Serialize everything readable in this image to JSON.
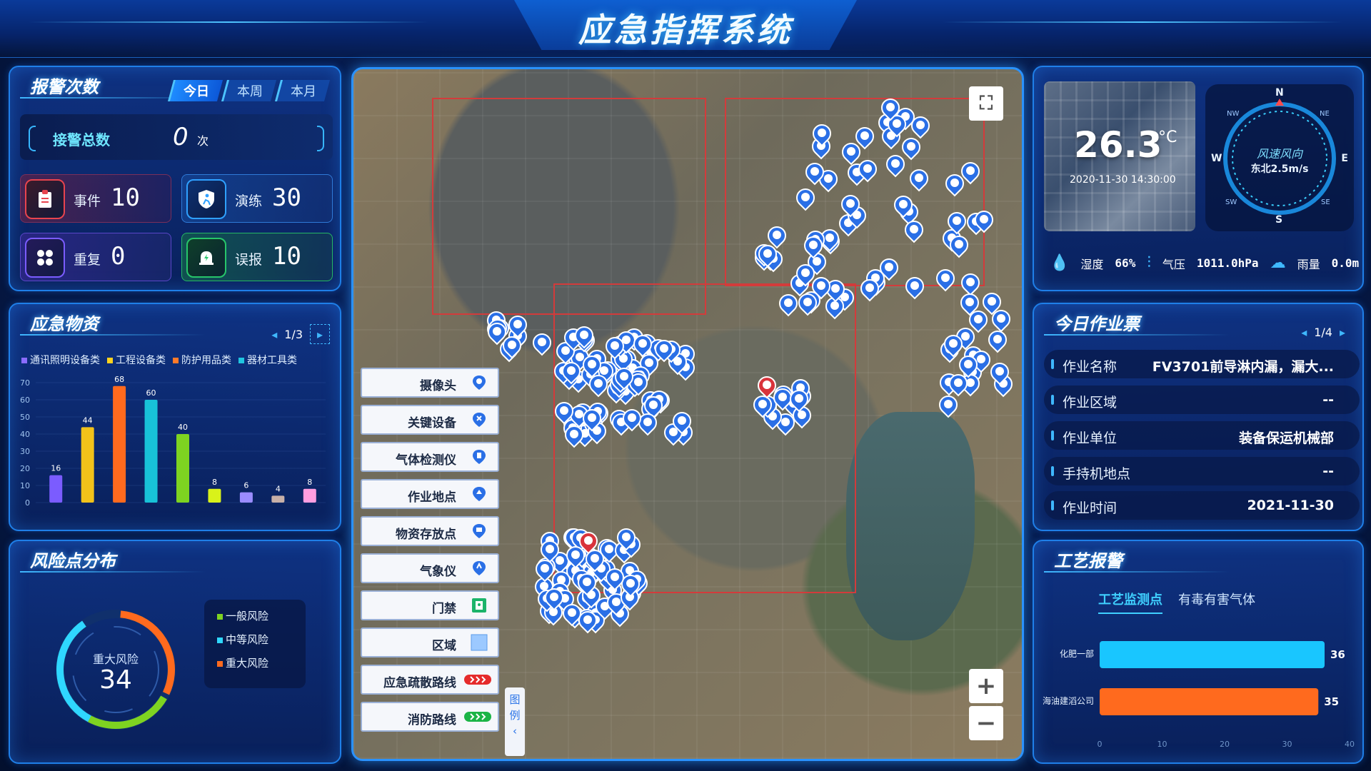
{
  "header": {
    "title": "应急指挥系统"
  },
  "alarm": {
    "title": "报警次数",
    "tabs": [
      "今日",
      "本周",
      "本月"
    ],
    "active_tab": "今日",
    "total_label": "接警总数",
    "total_value": "0",
    "total_unit": "次",
    "stats": [
      {
        "label": "事件",
        "value": "10",
        "icon": "clipboard-icon",
        "color": "#e8444e"
      },
      {
        "label": "演练",
        "value": "30",
        "icon": "shield-run-icon",
        "color": "#2fa0ff"
      },
      {
        "label": "重复",
        "value": "0",
        "icon": "grid-icon",
        "color": "#7a5cff"
      },
      {
        "label": "误报",
        "value": "10",
        "icon": "alarm-bell-icon",
        "color": "#27c56a"
      }
    ]
  },
  "supplies": {
    "title": "应急物资",
    "page": "1/3",
    "legend": [
      {
        "label": "通讯照明设备类",
        "color": "#8a6cff"
      },
      {
        "label": "工程设备类",
        "color": "#ffd21e"
      },
      {
        "label": "防护用品类",
        "color": "#ff7a2a"
      },
      {
        "label": "器材工具类",
        "color": "#20c6e0"
      }
    ]
  },
  "chart_data": {
    "type": "bar",
    "values": [
      16,
      44,
      68,
      60,
      40,
      8,
      6,
      4,
      8
    ],
    "colors": [
      "#7b5cff",
      "#f2c21a",
      "#ff6a1e",
      "#18c2d8",
      "#7ed321",
      "#d9f21a",
      "#9b8cff",
      "#c8b0a8",
      "#ff9ee0"
    ],
    "ylim": [
      0,
      70
    ],
    "yticks": [
      0,
      10,
      20,
      30,
      40,
      50,
      60,
      70
    ]
  },
  "risk": {
    "title": "风险点分布",
    "center_label": "重大风险",
    "center_value": "34",
    "legend": [
      {
        "label": "一般风险",
        "color": "#7ed321"
      },
      {
        "label": "中等风险",
        "color": "#2fd7ff"
      },
      {
        "label": "重大风险",
        "color": "#ff6a1e"
      }
    ]
  },
  "map": {
    "legend": [
      {
        "label": "摄像头",
        "icon": "camera-pin-icon"
      },
      {
        "label": "关键设备",
        "icon": "key-device-pin-icon"
      },
      {
        "label": "气体检测仪",
        "icon": "gas-detector-pin-icon"
      },
      {
        "label": "作业地点",
        "icon": "work-site-pin-icon"
      },
      {
        "label": "物资存放点",
        "icon": "storage-pin-icon"
      },
      {
        "label": "气象仪",
        "icon": "weather-pin-icon"
      },
      {
        "label": "门禁",
        "icon": "door-access-icon"
      },
      {
        "label": "区域",
        "icon": "area-swatch-icon"
      },
      {
        "label": "应急疏散路线",
        "icon": "evac-route-icon"
      },
      {
        "label": "消防路线",
        "icon": "fire-route-icon"
      }
    ],
    "legend_tab": [
      "图",
      "例"
    ]
  },
  "weather": {
    "temperature": "26.3",
    "temp_unit": "°C",
    "datetime": "2020-11-30  14:30:00",
    "wind_title": "风速风向",
    "wind_value": "东北2.5m/s",
    "compass": {
      "n": "N",
      "e": "E",
      "s": "S",
      "w": "W",
      "ne": "NE",
      "nw": "NW",
      "se": "SE",
      "sw": "SW"
    },
    "humidity_label": "湿度",
    "humidity": "66%",
    "pressure_label": "气压",
    "pressure": "1011.0hPa",
    "rain_label": "雨量",
    "rain": "0.0m"
  },
  "tickets": {
    "title": "今日作业票",
    "page": "1/4",
    "rows": [
      {
        "key": "作业名称",
        "value": "FV3701前导淋内漏，漏大..."
      },
      {
        "key": "作业区域",
        "value": "--"
      },
      {
        "key": "作业单位",
        "value": "装备保运机械部"
      },
      {
        "key": "手持机地点",
        "value": "--"
      },
      {
        "key": "作业时间",
        "value": "2021-11-30"
      }
    ]
  },
  "process": {
    "title": "工艺报警",
    "tabs": [
      "工艺监测点",
      "有毒有害气体"
    ],
    "active_tab": "工艺监测点",
    "bars": [
      {
        "label": "化肥一部",
        "value": 36,
        "color": "#19c6ff"
      },
      {
        "label": "海油建滔公司",
        "value": 35,
        "color": "#ff6a1e"
      }
    ],
    "xticks": [
      0,
      10,
      20,
      30,
      40
    ],
    "xlim": [
      0,
      40
    ]
  }
}
